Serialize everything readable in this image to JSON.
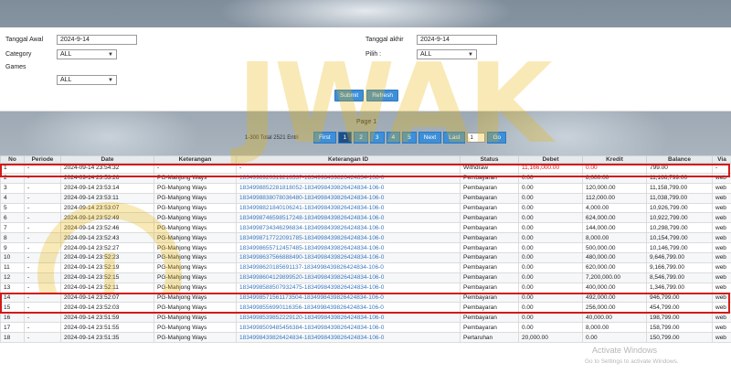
{
  "filters": {
    "tanggal_awal_label": "Tanggal Awal",
    "tanggal_awal_value": "2024-9-14",
    "tanggal_akhir_label": "Tanggal akhir",
    "tanggal_akhir_value": "2024-9-14",
    "category_label": "Category",
    "category_value": "ALL",
    "games_label": "Games",
    "games_value": "ALL",
    "pilih_label": "Pilih :",
    "pilih_value": "ALL",
    "submit_label": "Submit",
    "refresh_label": "Refresh"
  },
  "pagination": {
    "page_label": "Page 1",
    "entries": "1-300 Total 2521 Entri",
    "first": "First",
    "pages": [
      "1",
      "2",
      "3",
      "4",
      "5"
    ],
    "next": "Next",
    "last": "Last",
    "goto_value": "1",
    "go": "Go"
  },
  "table": {
    "headers": [
      "No",
      "Periode",
      "Date",
      "Keterangan",
      "Keterangan ID",
      "Status",
      "Debet",
      "Kredit",
      "Balance",
      "Via"
    ],
    "rows": [
      [
        "1",
        "-",
        "2024-09-14 23:54:32",
        "-",
        "-",
        "Withdraw",
        "11,166,000.00",
        "0.00",
        "799.00",
        "-"
      ],
      [
        "2",
        "-",
        "2024-09-14 23:53:26",
        "PG-Mahjong Ways",
        "1834998920319216537-1834998439826424834-106-0",
        "Pembayaran",
        "0.00",
        "8,000.00",
        "11,166,799.00",
        "web"
      ],
      [
        "3",
        "-",
        "2024-09-14 23:53:14",
        "PG-Mahjong Ways",
        "1834998852281818052-1834998439826424834-106-0",
        "Pembayaran",
        "0.00",
        "120,000.00",
        "11,158,799.00",
        "web"
      ],
      [
        "4",
        "-",
        "2024-09-14 23:53:11",
        "PG-Mahjong Ways",
        "1834998838078036480-1834998439826424834-106-0",
        "Pembayaran",
        "0.00",
        "112,000.00",
        "11,038,799.00",
        "web"
      ],
      [
        "5",
        "-",
        "2024-09-14 23:53:07",
        "PG-Mahjong Ways",
        "1834998821840106241-1834998439826424834-106-0",
        "Pembayaran",
        "0.00",
        "4,000.00",
        "10,926,799.00",
        "web"
      ],
      [
        "6",
        "-",
        "2024-09-14 23:52:49",
        "PG-Mahjong Ways",
        "1834998746598517248-1834998439826424834-106-0",
        "Pembayaran",
        "0.00",
        "624,000.00",
        "10,922,799.00",
        "web"
      ],
      [
        "7",
        "-",
        "2024-09-14 23:52:46",
        "PG-Mahjong Ways",
        "1834998734346296834-1834998439826424834-106-0",
        "Pembayaran",
        "0.00",
        "144,000.00",
        "10,298,799.00",
        "web"
      ],
      [
        "8",
        "-",
        "2024-09-14 23:52:43",
        "PG-Mahjong Ways",
        "1834998717722091785-1834998439826424834-106-0",
        "Pembayaran",
        "0.00",
        "8,000.00",
        "10,154,799.00",
        "web"
      ],
      [
        "9",
        "-",
        "2024-09-14 23:52:27",
        "PG-Mahjong Ways",
        "1834998655712457485-1834998439826424834-106-0",
        "Pembayaran",
        "0.00",
        "500,000.00",
        "10,146,799.00",
        "web"
      ],
      [
        "10",
        "-",
        "2024-09-14 23:52:23",
        "PG-Mahjong Ways",
        "1834998637566888490-1834998439826424834-106-0",
        "Pembayaran",
        "0.00",
        "480,000.00",
        "9,646,799.00",
        "web"
      ],
      [
        "11",
        "-",
        "2024-09-14 23:52:19",
        "PG-Mahjong Ways",
        "1834998620185691137-1834998439826424834-106-0",
        "Pembayaran",
        "0.00",
        "620,000.00",
        "9,166,799.00",
        "web"
      ],
      [
        "12",
        "-",
        "2024-09-14 23:52:15",
        "PG-Mahjong Ways",
        "1834998604129899520-1834998439826424834-106-0",
        "Pembayaran",
        "0.00",
        "7,200,000.00",
        "8,546,799.00",
        "web"
      ],
      [
        "13",
        "-",
        "2024-09-14 23:52:11",
        "PG-Mahjong Ways",
        "1834998588507932475-1834998439826424834-106-0",
        "Pembayaran",
        "0.00",
        "400,000.00",
        "1,346,799.00",
        "web"
      ],
      [
        "14",
        "-",
        "2024-09-14 23:52:07",
        "PG-Mahjong Ways",
        "1834998571561173504-1834998439826424834-106-0",
        "Pembayaran",
        "0.00",
        "492,000.00",
        "946,799.00",
        "web"
      ],
      [
        "15",
        "-",
        "2024-09-14 23:52:03",
        "PG-Mahjong Ways",
        "1834998556990116356-1834998439826424834-106-0",
        "Pembayaran",
        "0.00",
        "256,000.00",
        "454,799.00",
        "web"
      ],
      [
        "16",
        "-",
        "2024-09-14 23:51:59",
        "PG-Mahjong Ways",
        "1834998539852229120-1834998439826424834-106-0",
        "Pembayaran",
        "0.00",
        "40,000.00",
        "198,799.00",
        "web"
      ],
      [
        "17",
        "-",
        "2024-09-14 23:51:55",
        "PG-Mahjong Ways",
        "1834998509485456384-1834998439826424834-106-0",
        "Pembayaran",
        "0.00",
        "8,000.00",
        "158,799.00",
        "web"
      ],
      [
        "18",
        "-",
        "2024-09-14 23:51:35",
        "PG-Mahjong Ways",
        "1834998439826424834-1834998439826424834-106-0",
        "Pertaruhan",
        "20,000.00",
        "0.00",
        "150,799.00",
        "web"
      ]
    ]
  },
  "watermark": {
    "text": "JWAK",
    "color": "#e8b400"
  },
  "activation": {
    "title": "Activate Windows",
    "subtitle": "Go to Settings to activate Windows."
  },
  "colors": {
    "button_blue": "#3d8fd8",
    "link_blue": "#3a78c0",
    "negative_red": "#d01818",
    "highlight_red": "#d21a1a"
  }
}
